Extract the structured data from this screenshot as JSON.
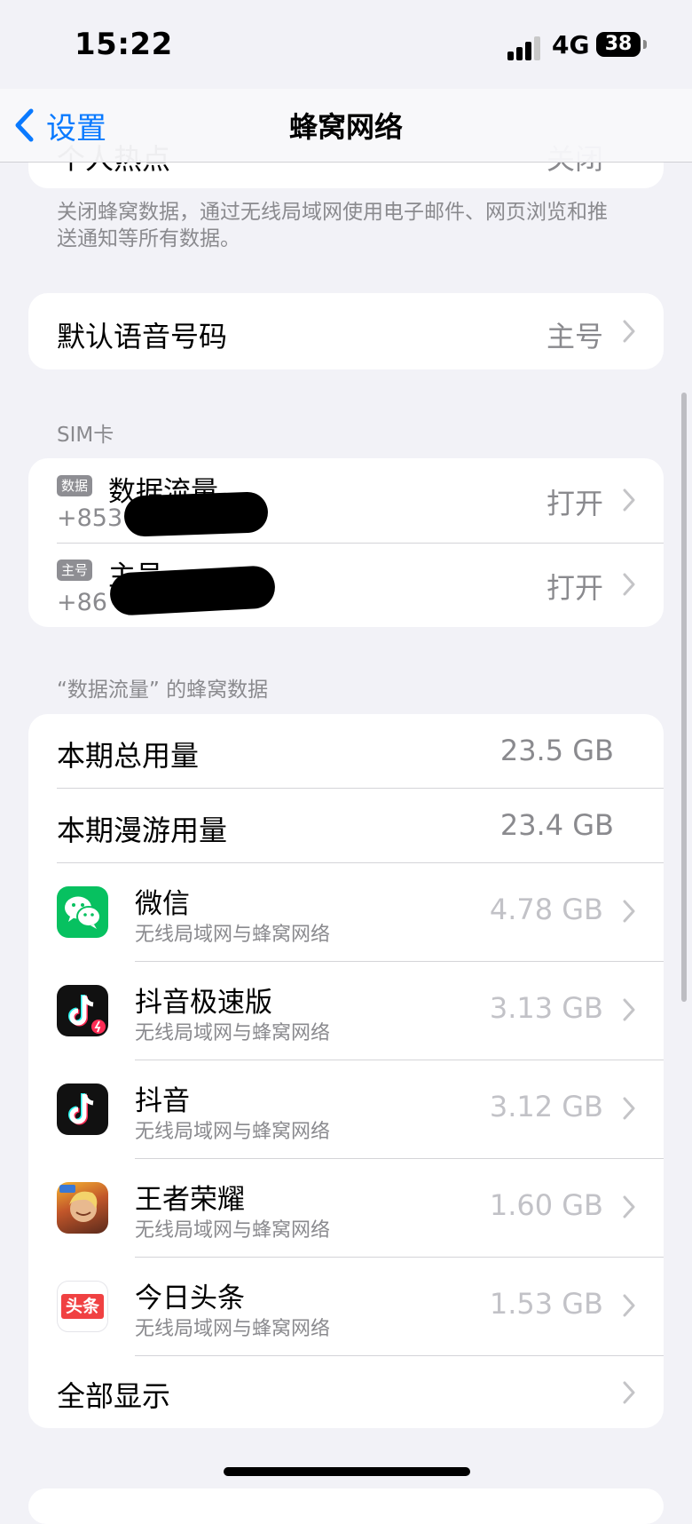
{
  "status_bar": {
    "time": "15:22",
    "network": "4G",
    "battery": "38"
  },
  "nav": {
    "back_label": "设置",
    "title": "蜂窝网络"
  },
  "top_card": {
    "label": "个人热点",
    "value": "关闭"
  },
  "cellular_footer": "关闭蜂窝数据，通过无线局域网使用电子邮件、网页浏览和推送通知等所有数据。",
  "voice": {
    "label": "默认语音号码",
    "value": "主号"
  },
  "sim": {
    "header": "SIM卡",
    "lines": [
      {
        "badge": "数据",
        "name": "数据流量",
        "number": "+853",
        "status": "打开"
      },
      {
        "badge": "主号",
        "name": "主号",
        "number": "+86",
        "status": "打开"
      }
    ]
  },
  "usage": {
    "header": "“数据流量” 的蜂窝数据",
    "total": {
      "label": "本期总用量",
      "value": "23.5 GB"
    },
    "roaming": {
      "label": "本期漫游用量",
      "value": "23.4 GB"
    },
    "apps": [
      {
        "name": "微信",
        "sub": "无线局域网与蜂窝网络",
        "value": "4.78 GB",
        "icon": "wechat-icon"
      },
      {
        "name": "抖音极速版",
        "sub": "无线局域网与蜂窝网络",
        "value": "3.13 GB",
        "icon": "douyin-lite-icon"
      },
      {
        "name": "抖音",
        "sub": "无线局域网与蜂窝网络",
        "value": "3.12 GB",
        "icon": "douyin-icon"
      },
      {
        "name": "王者荣耀",
        "sub": "无线局域网与蜂窝网络",
        "value": "1.60 GB",
        "icon": "honor-of-kings-icon"
      },
      {
        "name": "今日头条",
        "sub": "无线局域网与蜂窝网络",
        "value": "1.53 GB",
        "icon": "toutiao-icon",
        "icon_text": "头条"
      }
    ],
    "show_all": "全部显示"
  },
  "colors": {
    "accent": "#0a7aff",
    "wechat": "#07c160",
    "toutiao": "#f04142"
  }
}
